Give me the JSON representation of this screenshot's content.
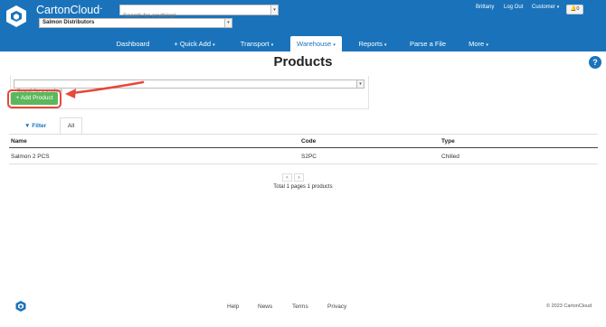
{
  "header": {
    "brand": "CartonCloud",
    "brand_suffix": "-",
    "search_placeholder": "Search for anything!",
    "company": "Salmon Distributors",
    "user": "Brittany",
    "logout": "Log Out",
    "customer": "Customer",
    "notifications": "0"
  },
  "nav": {
    "items": [
      {
        "label": "Dashboard"
      },
      {
        "label": "+ Quick Add"
      },
      {
        "label": "Transport"
      },
      {
        "label": "Warehouse"
      },
      {
        "label": "Reports"
      },
      {
        "label": "Parse a File"
      },
      {
        "label": "More"
      }
    ]
  },
  "page": {
    "title": "Products",
    "help": "?",
    "product_search_placeholder": "Search for a product",
    "add_button": "+ Add Product"
  },
  "tabs": {
    "filter": "Filter",
    "all": "All"
  },
  "table": {
    "columns": [
      "Name",
      "Code",
      "Type"
    ],
    "rows": [
      [
        "Salmon 2 PCS",
        "S2PC",
        "Chilled"
      ]
    ]
  },
  "pagination": {
    "prev": "<",
    "next": ">",
    "summary": "Total 1 pages 1 products"
  },
  "footer": {
    "links": [
      "Help",
      "News",
      "Terms",
      "Privacy"
    ],
    "copyright": "© 2023 CartonCloud"
  },
  "colors": {
    "brand_blue": "#1a73ba",
    "add_green": "#5cb85c",
    "highlight_red": "#e8483a"
  }
}
